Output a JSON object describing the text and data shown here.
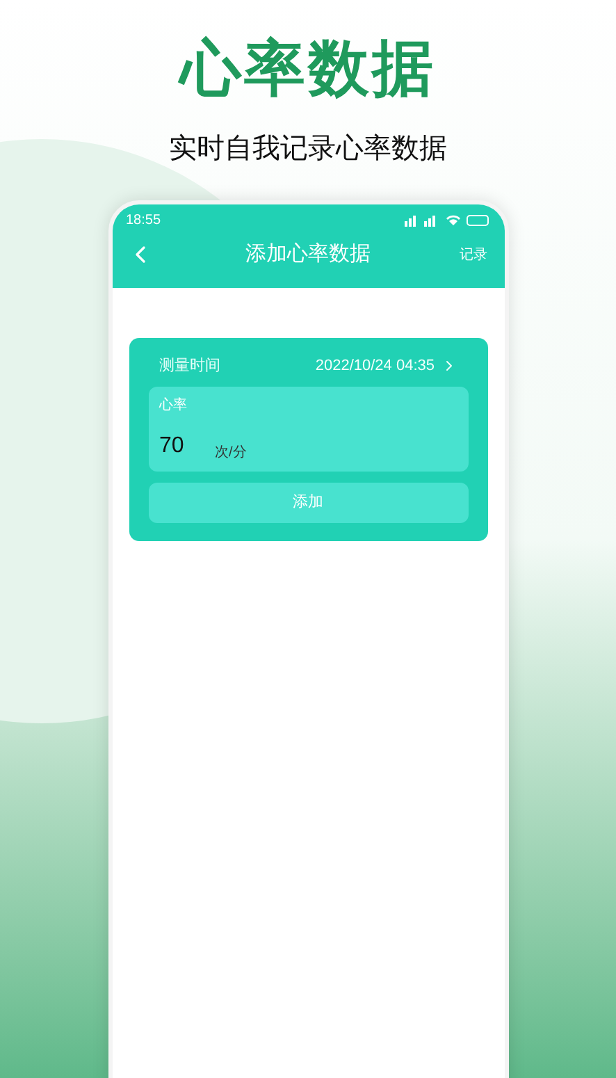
{
  "headline": {
    "title": "心率数据",
    "subtitle": "实时自我记录心率数据"
  },
  "status_bar": {
    "time": "18:55"
  },
  "nav": {
    "title": "添加心率数据",
    "action": "记录"
  },
  "form": {
    "time_label": "测量时间",
    "time_value": "2022/10/24 04:35",
    "field_label": "心率",
    "field_value": "70",
    "unit": "次/分",
    "submit": "添加"
  }
}
